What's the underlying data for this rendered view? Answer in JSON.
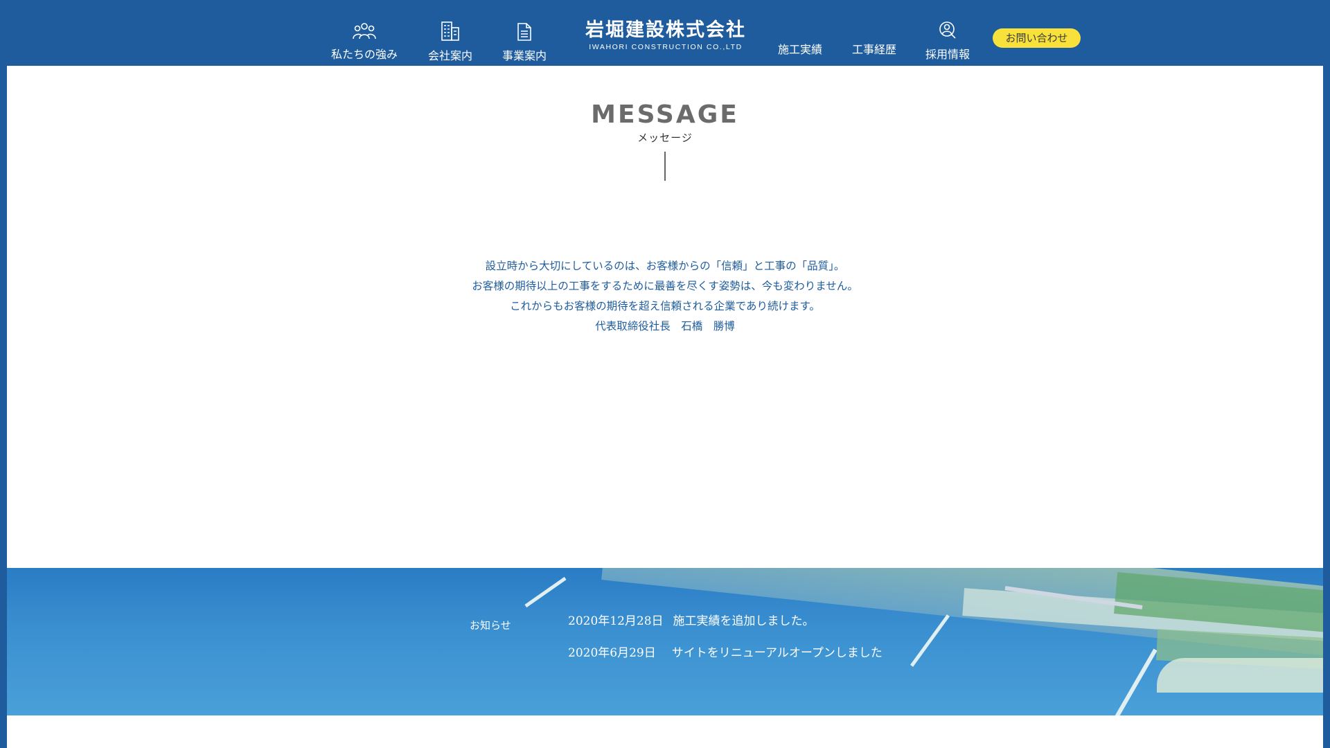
{
  "header": {
    "nav_left": [
      {
        "label": "私たちの強み",
        "icon": "people-icon"
      },
      {
        "label": "会社案内",
        "icon": "building-icon"
      },
      {
        "label": "事業案内",
        "icon": "document-icon"
      }
    ],
    "logo": {
      "main": "岩堀建設株式会社",
      "sub": "IWAHORI CONSTRUCTION CO.,LTD"
    },
    "nav_right": [
      {
        "label": "施工実績"
      },
      {
        "label": "工事経歴"
      },
      {
        "label": "採用情報",
        "icon": "person-search-icon"
      }
    ],
    "contact_label": "お問い合わせ"
  },
  "message": {
    "title": "MESSAGE",
    "subtitle": "メッセージ",
    "lines": [
      "設立時から大切にしているのは、お客様からの「信頼」と工事の「品質」。",
      "お客様の期待以上の工事をするために最善を尽くす姿勢は、今も変わりません。",
      "これからもお客様の期待を超え信頼される企業であり続けます。",
      "代表取締役社長　石橋　勝博"
    ]
  },
  "news": {
    "label": "お知らせ",
    "items": [
      {
        "date": "2020年12月28日",
        "text": "施工実績を追加しました。"
      },
      {
        "date": "2020年6月29日",
        "text": "サイトをリニューアルオープンしました"
      }
    ]
  },
  "colors": {
    "primary": "#1e5c9e",
    "accent": "#f7e13a",
    "title_gray": "#6b6b6b"
  }
}
